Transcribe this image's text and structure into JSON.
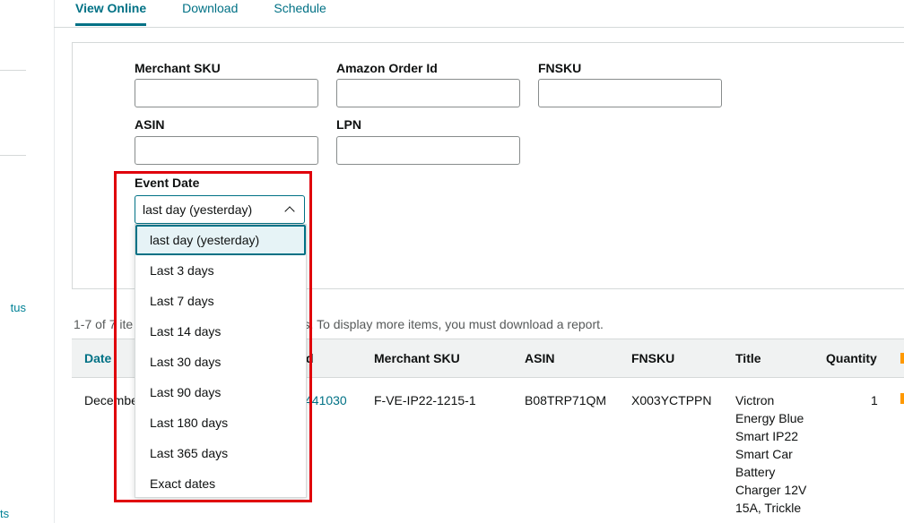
{
  "tabs": [
    {
      "label": "View Online",
      "active": true
    },
    {
      "label": "Download",
      "active": false
    },
    {
      "label": "Schedule",
      "active": false
    }
  ],
  "sidebar": {
    "item_1": "tus",
    "item_2": "ts"
  },
  "filters": {
    "merchant_sku": {
      "label": "Merchant SKU",
      "value": ""
    },
    "amazon_order_id": {
      "label": "Amazon Order Id",
      "value": ""
    },
    "fnsku": {
      "label": "FNSKU",
      "value": ""
    },
    "asin": {
      "label": "ASIN",
      "value": ""
    },
    "lpn": {
      "label": "LPN",
      "value": ""
    },
    "event_date": {
      "label": "Event Date",
      "selected": "last day (yesterday)",
      "options": [
        "last day (yesterday)",
        "Last 3 days",
        "Last 7 days",
        "Last 14 days",
        "Last 30 days",
        "Last 90 days",
        "Last 180 days",
        "Last 365 days",
        "Exact dates"
      ]
    }
  },
  "results": {
    "summary_prefix": "1-7 of 7 ite",
    "summary_suffix": "d to 10,000 items. To display more items, you must download a report."
  },
  "table": {
    "headers": {
      "date": "Date",
      "order_id": "d",
      "merchant_sku": "Merchant SKU",
      "asin": "ASIN",
      "fnsku": "FNSKU",
      "title": "Title",
      "quantity": "Quantity"
    },
    "rows": [
      {
        "date": "Decembe",
        "order_id": "441030",
        "merchant_sku": "F-VE-IP22-1215-1",
        "asin": "B08TRP71QM",
        "fnsku": "X003YCTPPN",
        "title": "Victron Energy Blue Smart IP22 Smart Car Battery Charger 12V 15A, Trickle",
        "quantity": "1"
      }
    ]
  },
  "colors": {
    "accent": "#007185",
    "highlight": "#e0000b",
    "header_bg": "#f0f2f2"
  }
}
